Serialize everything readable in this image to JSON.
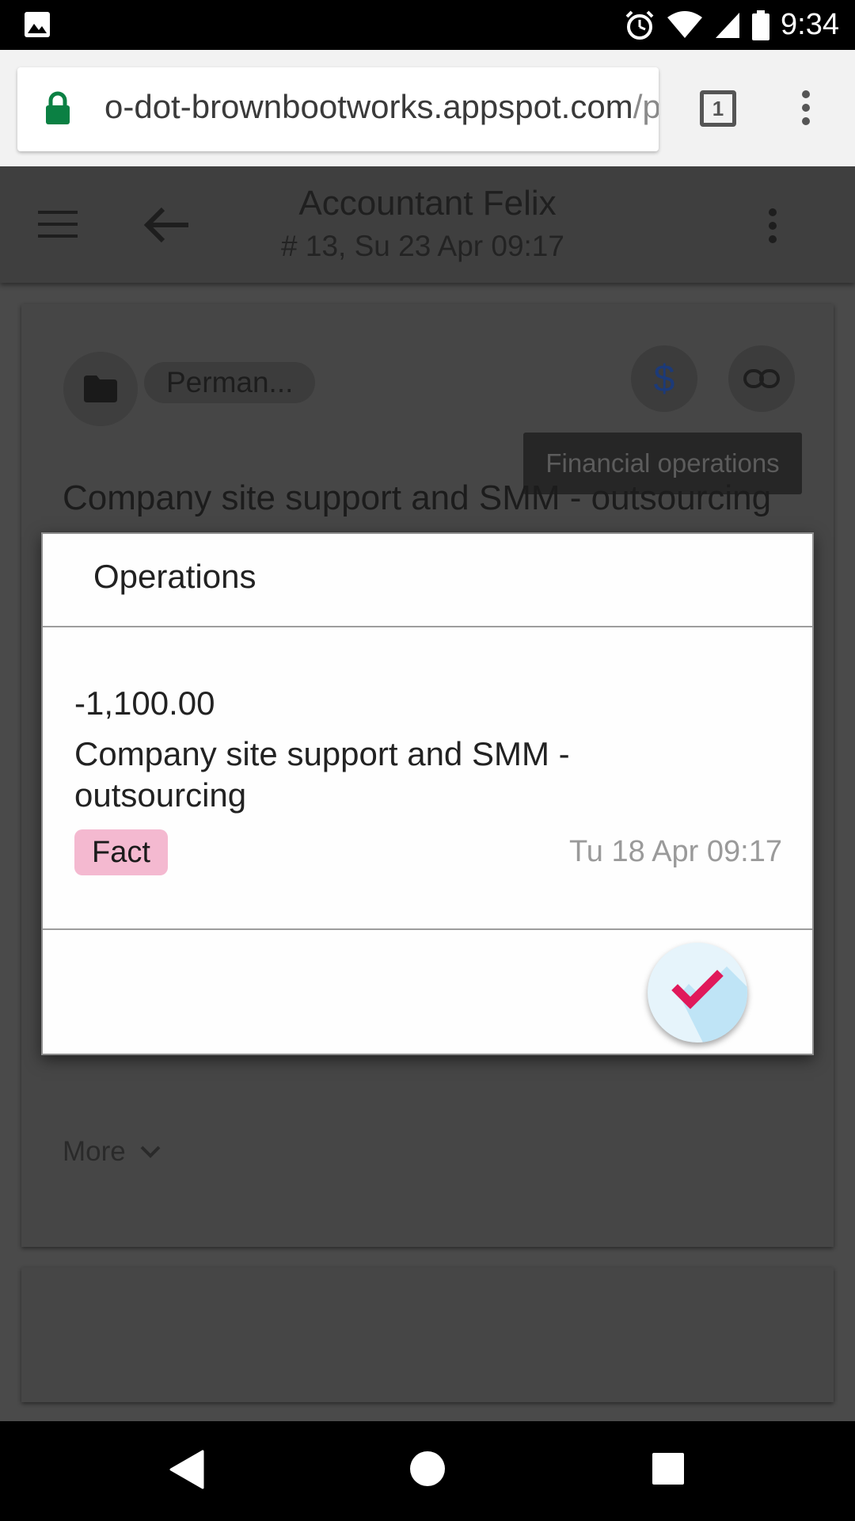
{
  "status_bar": {
    "time": "9:34",
    "icons": [
      "image-icon",
      "alarm-icon",
      "wifi-icon",
      "signal-icon",
      "battery-icon"
    ]
  },
  "browser": {
    "url_main": "o-dot-brownbootworks.appspot.com",
    "url_path": "/p",
    "tab_count": "1"
  },
  "app_bar": {
    "title": "Accountant Felix",
    "subtitle": "# 13, Su 23 Apr 09:17"
  },
  "card": {
    "chip_label": "Perman...",
    "currency_symbol": "$",
    "tooltip": "Financial operations",
    "heading": "Company site support and SMM - outsourcing",
    "more_label": "More"
  },
  "dialog": {
    "title": "Operations",
    "operation": {
      "amount": "-1,100.00",
      "description": "Company site support and SMM - outsourcing",
      "badge": "Fact",
      "date": "Tu 18 Apr 09:17"
    }
  },
  "colors": {
    "fab_check": "#e0195a",
    "fact_badge": "#f4b9d0",
    "lock": "#0b8043"
  }
}
